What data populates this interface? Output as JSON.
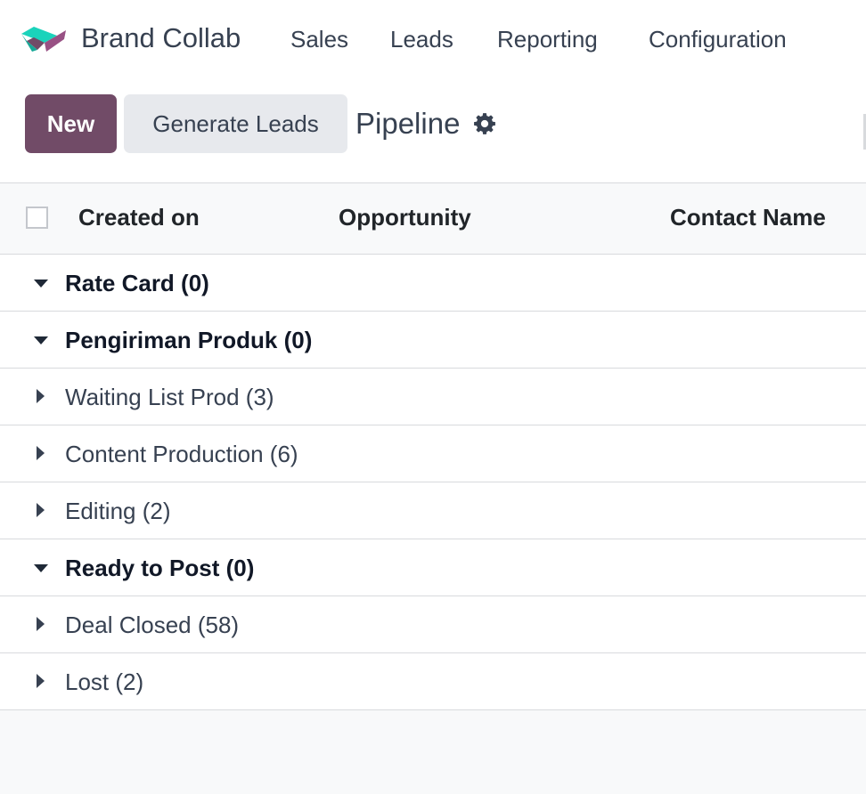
{
  "navbar": {
    "app_name": "Brand Collab",
    "menu": [
      "Sales",
      "Leads",
      "Reporting",
      "Configuration"
    ],
    "logo_colors": [
      "#1ad3bb",
      "#714b67",
      "#985184"
    ]
  },
  "control_panel": {
    "new_label": "New",
    "generate_leads_label": "Generate Leads",
    "title": "Pipeline",
    "settings_icon": "gear-icon"
  },
  "list": {
    "columns": [
      "Created on",
      "Opportunity",
      "Contact Name"
    ],
    "groups": [
      {
        "label": "Rate Card (0)",
        "expanded": true
      },
      {
        "label": "Pengiriman Produk (0)",
        "expanded": true
      },
      {
        "label": "Waiting List Prod (3)",
        "expanded": false
      },
      {
        "label": "Content Production (6)",
        "expanded": false
      },
      {
        "label": "Editing (2)",
        "expanded": false
      },
      {
        "label": "Ready to Post (0)",
        "expanded": true
      },
      {
        "label": "Deal Closed (58)",
        "expanded": false
      },
      {
        "label": "Lost (2)",
        "expanded": false
      }
    ]
  },
  "colors": {
    "accent": "#714b67",
    "secondary_button": "#e7e9ed",
    "border": "#d8dadd",
    "background": "#f8f9fa"
  }
}
